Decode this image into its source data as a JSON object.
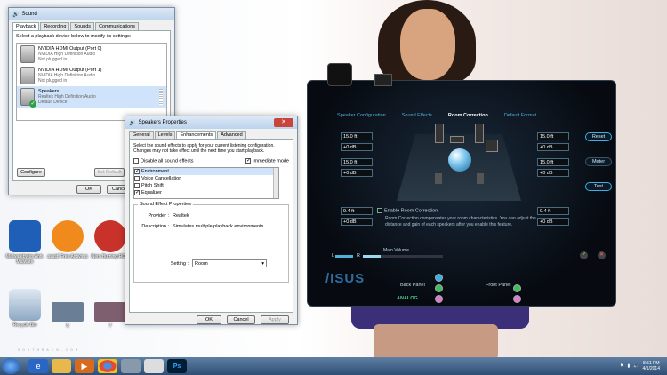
{
  "wallpaper": {
    "watermark": "SOUTHMAIN.COM"
  },
  "sound": {
    "title": "Sound",
    "tabs": [
      "Playback",
      "Recording",
      "Sounds",
      "Communications"
    ],
    "instructions": "Select a playback device below to modify its settings:",
    "devices": [
      {
        "name": "NVIDIA HDMI Output (Port 0)",
        "driver": "NVIDIA High Definition Audio",
        "status": "Not plugged in"
      },
      {
        "name": "NVIDIA HDMI Output (Port 1)",
        "driver": "NVIDIA High Definition Audio",
        "status": "Not plugged in"
      },
      {
        "name": "Speakers",
        "driver": "Realtek High Definition Audio",
        "status": "Default Device"
      }
    ],
    "configure": "Configure",
    "set_default": "Set Default",
    "ok": "OK",
    "cancel": "Cance"
  },
  "props": {
    "title": "Speakers Properties",
    "tabs": [
      "General",
      "Levels",
      "Enhancements",
      "Advanced"
    ],
    "intro": "Select the sound effects to apply for your current listening configuration. Changes may not take effect until the next time you start playback.",
    "disable_all": "Disable all sound effects",
    "immediate": "Immediate mode",
    "effects": [
      {
        "label": "Environment",
        "checked": true
      },
      {
        "label": "Voice Cancellation",
        "checked": false
      },
      {
        "label": "Pitch Shift",
        "checked": false
      },
      {
        "label": "Equalizer",
        "checked": true
      }
    ],
    "group_title": "Sound Effect Properties",
    "provider_label": "Provider :",
    "provider": "Realtek",
    "desc_label": "Description :",
    "description": "Simulates multiple playback environments.",
    "setting_label": "Setting :",
    "setting": "Room",
    "ok": "OK",
    "cancel": "Cancel",
    "apply": "Apply"
  },
  "asus": {
    "tabs": [
      "Speaker Configuration",
      "Sound Effects",
      "Room Correction",
      "Default Format"
    ],
    "active_tab": "Room Correction",
    "left_dist": [
      "15.0 ft",
      "15.0 ft",
      "9.4 ft"
    ],
    "left_db": [
      "+0 dB",
      "+0 dB",
      "+0 dB"
    ],
    "right_dist": [
      "15.0 ft",
      "15.0 ft",
      "9.4 ft"
    ],
    "right_db": [
      "+0 dB",
      "+0 dB",
      "+0 dB"
    ],
    "buttons": [
      "Reset",
      "Meter",
      "Test"
    ],
    "enable": "Enable Room Correction",
    "note": "Room Correction compensates your room characteristics. You can adjust the distance and gain of each speakers after you enable this feature.",
    "main_volume": "Main Volume",
    "l": "L",
    "r": "R",
    "back_panel": "Back Panel",
    "front_panel": "Front Panel",
    "analog": "ANALOG",
    "logo": "/ISUS"
  },
  "desktop": {
    "icons": [
      {
        "label": "Malwarebytes Anti-Malware",
        "color": "#1f5fb8"
      },
      {
        "label": "avast! Free Antivirus",
        "color": "#f08a1c"
      },
      {
        "label": "Nero Burning ROM",
        "color": "#c8322a"
      },
      {
        "label": "Recycle Bin",
        "color": "#9fb7cf"
      },
      {
        "label": "5",
        "color": "#6a7f96"
      },
      {
        "label": "7",
        "color": "#7d5f6f"
      }
    ]
  },
  "taskbar": {
    "time": "8:51 PM",
    "date": "4/1/2014",
    "ps": "Ps"
  }
}
